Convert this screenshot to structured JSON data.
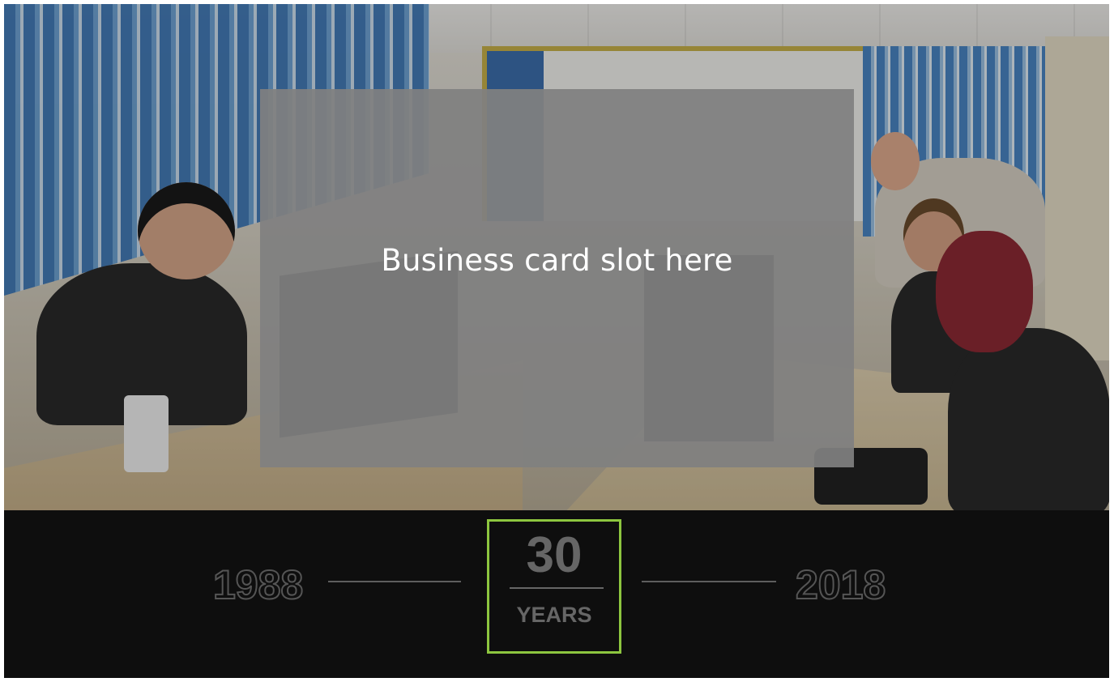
{
  "slide": {
    "placeholder_text": "Business card slot here"
  },
  "timeline": {
    "start_year": "1988",
    "end_year": "2018",
    "badge_number": "30",
    "badge_label": "YEARS"
  },
  "colors": {
    "background": "#0e0e0e",
    "accent_border": "#8dc63f",
    "placeholder_fill": "#808080",
    "muted_text": "#666666"
  },
  "image": {
    "subject": "office-photo"
  }
}
